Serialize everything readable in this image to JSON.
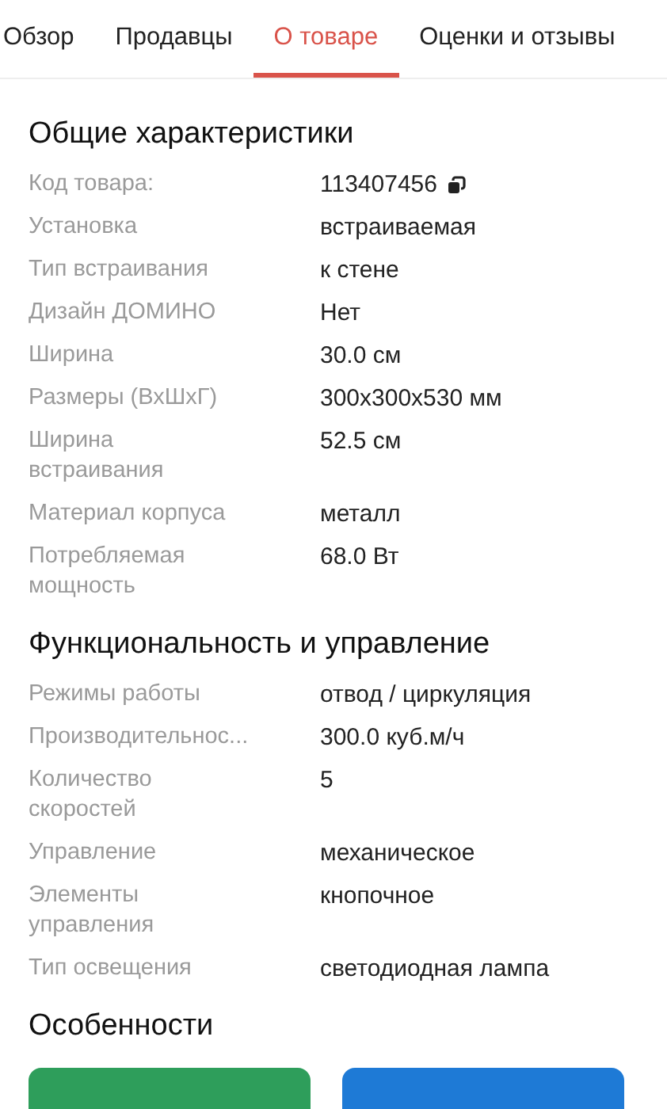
{
  "tabs": [
    {
      "label": "Обзор",
      "selected": false
    },
    {
      "label": "Продавцы",
      "selected": false
    },
    {
      "label": "О товаре",
      "selected": true
    },
    {
      "label": "Оценки и отзывы",
      "selected": false
    }
  ],
  "sections": [
    {
      "title": "Общие характеристики",
      "rows": [
        {
          "label": "Код товара:",
          "value": "113407456",
          "copyable": true
        },
        {
          "label": "Установка",
          "value": "встраиваемая"
        },
        {
          "label": "Тип встраивания",
          "value": "к стене"
        },
        {
          "label": "Дизайн ДОМИНО",
          "value": "Нет"
        },
        {
          "label": "Ширина",
          "value": "30.0 см"
        },
        {
          "label": "Размеры (ВхШхГ)",
          "value": "300x300x530 мм"
        },
        {
          "label": "Ширина встраивания",
          "value": "52.5 см"
        },
        {
          "label": "Материал корпуса",
          "value": "металл"
        },
        {
          "label": "Потребляемая мощность",
          "value": "68.0 Вт"
        }
      ]
    },
    {
      "title": "Функциональность и управление",
      "rows": [
        {
          "label": "Режимы работы",
          "value": "отвод / циркуляция"
        },
        {
          "label": "Производительнос...",
          "value": "300.0 куб.м/ч"
        },
        {
          "label": "Количество скоростей",
          "value": "5"
        },
        {
          "label": "Управление",
          "value": "механическое"
        },
        {
          "label": "Элементы управления",
          "value": "кнопочное"
        },
        {
          "label": "Тип освещения",
          "value": "светодиодная лампа"
        }
      ]
    },
    {
      "title": "Особенности",
      "tags": [
        {
          "color": "#2e9e5b"
        },
        {
          "color": "#1e7ad6"
        }
      ]
    }
  ]
}
